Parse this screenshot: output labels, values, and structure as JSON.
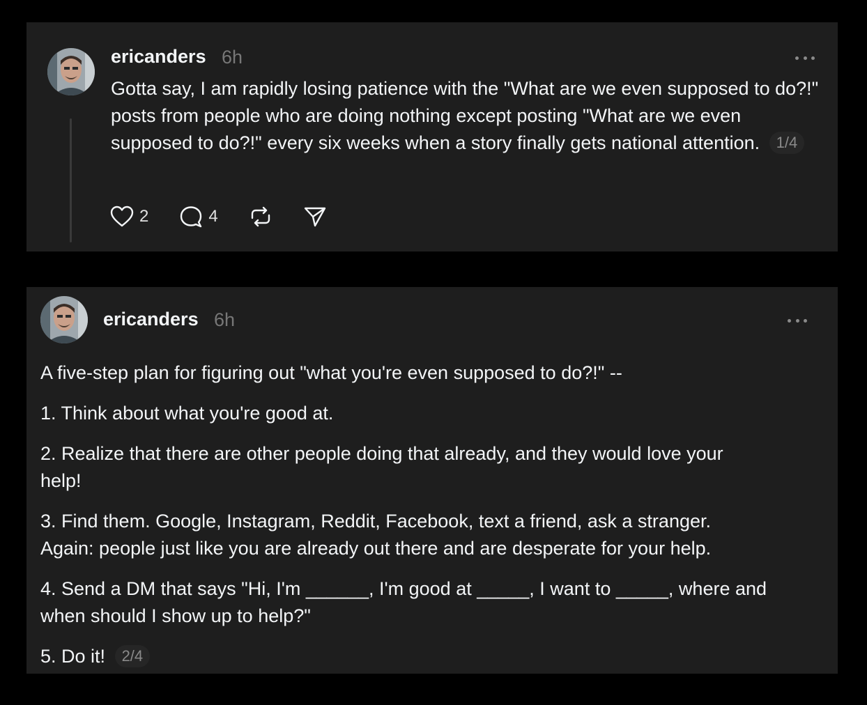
{
  "posts": [
    {
      "username": "ericanders",
      "time": "6h",
      "text": "Gotta say, I am rapidly losing patience with the \"What are we even supposed to do?!\" posts from people who are doing nothing except posting \"What are we even supposed to do?!\" every six weeks when a story finally gets national attention.",
      "pager": "1/4",
      "likes": "2",
      "replies": "4"
    },
    {
      "username": "ericanders",
      "time": "6h",
      "paragraphs": [
        "A five-step plan for figuring out \"what you're even supposed to do?!\" --",
        "1. Think about what you're good at.",
        "2. Realize that there are other people doing that already, and they would love your help!",
        "3. Find them. Google, Instagram, Reddit, Facebook, text a friend, ask a stranger. Again: people just like you are already out there and are desperate for your help.",
        "4. Send a DM that says \"Hi, I'm ______, I'm good at _____, I want to _____, where and when should I show up to help?\"",
        "5. Do it!"
      ],
      "pager": "2/4"
    }
  ],
  "icons": [
    "avatar",
    "more-icon",
    "heart-icon",
    "comment-icon",
    "repost-icon",
    "share-icon"
  ]
}
